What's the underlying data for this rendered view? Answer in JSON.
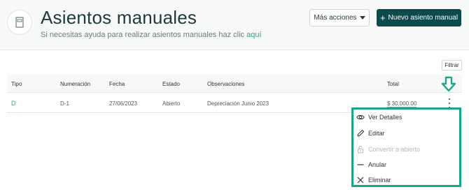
{
  "header": {
    "title": "Asientos manuales",
    "subtitle_text": "Si necesitas ayuda para realizar asientos manuales haz clic",
    "help_link": "aquí",
    "more_actions_label": "Más acciones",
    "new_entry_label": "Nuevo asiento manual",
    "avatar_icon": "document-icon"
  },
  "filter_label": "Filtrar",
  "table": {
    "columns": [
      "Tipo",
      "Numeración",
      "Fecha",
      "Estado",
      "Observaciones",
      "Total"
    ],
    "rows": [
      {
        "tipo": "D",
        "numeracion": "D-1",
        "fecha": "27/06/2023",
        "estado": "Abierto",
        "observaciones": "Depreciación Junio 2023",
        "total": "$ 30,000.00"
      }
    ]
  },
  "menu": {
    "items": [
      {
        "label": "Ver Detalles",
        "icon": "eye-icon",
        "enabled": true
      },
      {
        "label": "Editar",
        "icon": "pencil-icon",
        "enabled": true
      },
      {
        "label": "Convertir a abierto",
        "icon": "lock-open-icon",
        "enabled": false
      },
      {
        "label": "Anular",
        "icon": "minus-icon",
        "enabled": true
      },
      {
        "label": "Eliminar",
        "icon": "close-icon",
        "enabled": true
      }
    ]
  },
  "colors": {
    "brand_dark": "#0d4a4c",
    "accent": "#25a68a",
    "highlight_border": "#1ba58a",
    "header_bg": "#f7f8f8"
  }
}
